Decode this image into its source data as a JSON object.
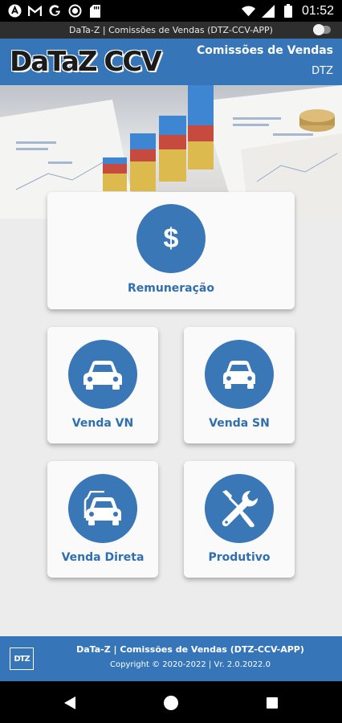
{
  "status_bar": {
    "time": "01:52",
    "icons": [
      "app-a-icon",
      "gmail-icon",
      "google-icon",
      "record-icon",
      "sd-card-icon",
      "wifi-icon",
      "signal-icon",
      "battery-icon"
    ]
  },
  "title_strip": {
    "text": "DaTa-Z  |  Comissões de Vendas (DTZ-CCV-APP)"
  },
  "header": {
    "logo": "DaTaZ CCV",
    "title": "Comissões de Vendas",
    "subtitle": "DTZ"
  },
  "menu": {
    "remuneracao": {
      "label": "Remuneração",
      "icon": "dollar-icon"
    },
    "venda_vn": {
      "label": "Venda VN",
      "icon": "car-icon"
    },
    "venda_sn": {
      "label": "Venda SN",
      "icon": "car-icon"
    },
    "venda_direta": {
      "label": "Venda Direta",
      "icon": "cars-icon"
    },
    "produtivo": {
      "label": "Produtivo",
      "icon": "tools-icon"
    }
  },
  "footer": {
    "logo": "DTZ",
    "line1": "DaTa-Z  |  Comissões de Vendas (DTZ-CCV-APP)",
    "line2": "Copyright © 2020-2022  |  Vr. 2.0.2022.0"
  },
  "colors": {
    "brand_blue": "#3575b8",
    "circle_blue": "#3a77b7",
    "label_blue": "#2f6fb0"
  }
}
